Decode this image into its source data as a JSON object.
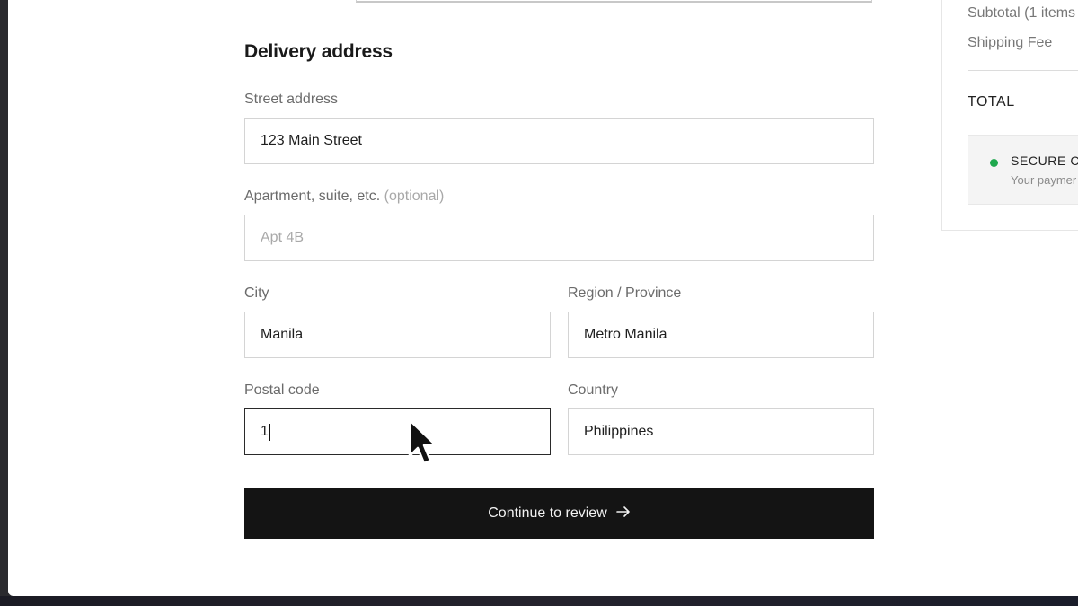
{
  "delivery": {
    "title": "Delivery address",
    "street": {
      "label": "Street address",
      "value": "123 Main Street"
    },
    "apartment": {
      "label": "Apartment, suite, etc.",
      "optional": "(optional)",
      "placeholder": "Apt 4B"
    },
    "city": {
      "label": "City",
      "value": "Manila"
    },
    "region": {
      "label": "Region / Province",
      "value": "Metro Manila"
    },
    "postal": {
      "label": "Postal code",
      "value": "1"
    },
    "country": {
      "label": "Country",
      "value": "Philippines"
    }
  },
  "continue": {
    "label": "Continue to review",
    "icon": "arrow-right-icon"
  },
  "summary": {
    "subtotal": "Subtotal (1 items",
    "shipping": "Shipping Fee",
    "total": "TOTAL",
    "secure_title": "SECURE CH",
    "secure_sub": "Your paymer",
    "secure_color": "#1fa84e"
  },
  "colors": {
    "button_bg": "#141414",
    "page_bg": "#ffffff"
  }
}
